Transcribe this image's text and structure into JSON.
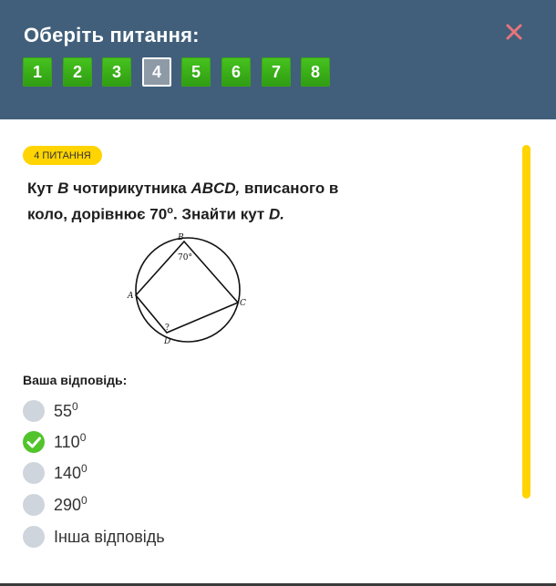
{
  "header": {
    "title": "Оберіть питання:",
    "questions": [
      "1",
      "2",
      "3",
      "4",
      "5",
      "6",
      "7",
      "8"
    ],
    "current_index": 3
  },
  "question": {
    "badge": "4 питання",
    "text_part1": "Кут ",
    "text_B": "B",
    "text_part2": " чотирикутника ",
    "text_ABCD": "ABCD,",
    "text_part3": " вписаного в коло, дорівнює 70",
    "text_deg": "о",
    "text_part4": ". Знайти  кут ",
    "text_D": "D.",
    "figure": {
      "label_A": "A",
      "label_B": "B",
      "label_C": "C",
      "label_D": "D",
      "angle_B": "70°",
      "angle_D": "?"
    }
  },
  "answer": {
    "label": "Ваша відповідь:",
    "options": [
      {
        "value": "55",
        "sup": "0",
        "checked": false
      },
      {
        "value": "110",
        "sup": "0",
        "checked": true
      },
      {
        "value": "140",
        "sup": "0",
        "checked": false
      },
      {
        "value": "290",
        "sup": "0",
        "checked": false
      },
      {
        "value": "Інша відповідь",
        "sup": "",
        "checked": false
      }
    ]
  },
  "colors": {
    "header_bg": "#415f7a",
    "nav_button": "#3fb41b",
    "badge": "#ffd400",
    "checked": "#52c42b",
    "close_icon": "#e8747a"
  },
  "icons": {
    "close": "close-icon",
    "check": "check-icon"
  }
}
